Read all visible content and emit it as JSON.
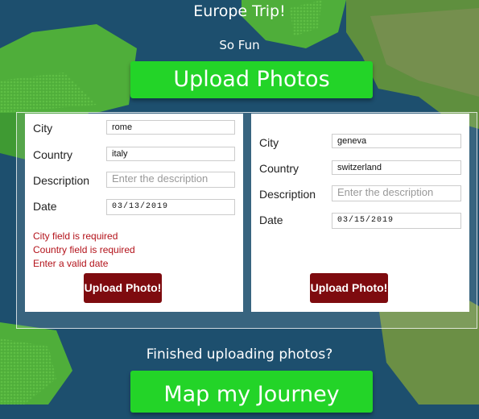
{
  "header": {
    "title": "Europe Trip!",
    "subtitle": "So Fun",
    "upload_photos_label": "Upload Photos"
  },
  "forms": [
    {
      "city_label": "City",
      "city_value": "rome",
      "country_label": "Country",
      "country_value": "italy",
      "description_label": "Description",
      "description_placeholder": "Enter the description",
      "date_label": "Date",
      "date_value": "03/13/2019",
      "errors": [
        "City field is required",
        "Country field is required",
        "Enter a valid date"
      ],
      "submit_label": "Upload Photo!"
    },
    {
      "city_label": "City",
      "city_value": "geneva",
      "country_label": "Country",
      "country_value": "switzerland",
      "description_label": "Description",
      "description_placeholder": "Enter the description",
      "date_label": "Date",
      "date_value": "03/15/2019",
      "errors": [],
      "submit_label": "Upload Photo!"
    }
  ],
  "footer": {
    "prompt": "Finished uploading photos?",
    "map_label": "Map my Journey"
  },
  "colors": {
    "ocean": "#1d4f6e",
    "land": "#4fae3a",
    "primary_button": "#23d428",
    "submit_button": "#7e0b0f",
    "error_text": "#b3121a"
  }
}
